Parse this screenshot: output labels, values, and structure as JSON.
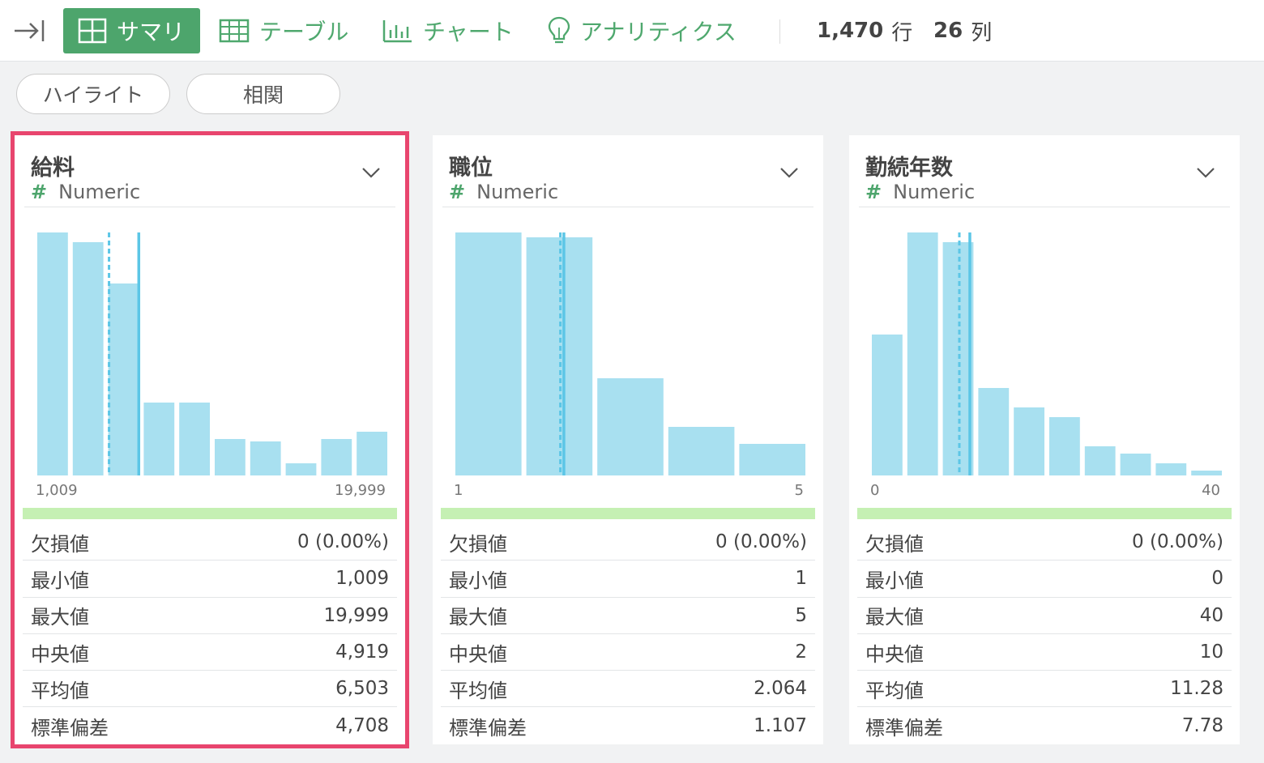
{
  "toolbar": {
    "tabs": [
      {
        "label": "サマリ",
        "icon": "grid-icon",
        "active": true
      },
      {
        "label": "テーブル",
        "icon": "table-icon",
        "active": false
      },
      {
        "label": "チャート",
        "icon": "bar-chart-icon",
        "active": false
      },
      {
        "label": "アナリティクス",
        "icon": "lightbulb-icon",
        "active": false
      }
    ],
    "rows_value": "1,470",
    "rows_unit": "行",
    "cols_value": "26",
    "cols_unit": "列"
  },
  "subtabs": [
    "ハイライト",
    "相関"
  ],
  "colors": {
    "accent_green": "#4da56c",
    "bar": "#a8e0f0",
    "median_line": "#5cc6e6",
    "quality_bar": "#c5f0b3",
    "selection": "#e8456e"
  },
  "cards": [
    {
      "title": "給料",
      "type_symbol": "#",
      "type": "Numeric",
      "selected": true,
      "axis_min": "1,009",
      "axis_max": "19,999",
      "chart_data": {
        "type": "bar",
        "bins_relative": [
          1.0,
          0.96,
          0.79,
          0.3,
          0.3,
          0.15,
          0.14,
          0.05,
          0.15,
          0.18
        ],
        "median_fraction": 0.205,
        "mean_fraction": 0.29
      },
      "stats": [
        {
          "label": "欠損値",
          "value": "0 (0.00%)"
        },
        {
          "label": "最小値",
          "value": "1,009"
        },
        {
          "label": "最大値",
          "value": "19,999"
        },
        {
          "label": "中央値",
          "value": "4,919"
        },
        {
          "label": "平均値",
          "value": "6,503"
        },
        {
          "label": "標準偏差",
          "value": "4,708"
        }
      ]
    },
    {
      "title": "職位",
      "type_symbol": "#",
      "type": "Numeric",
      "selected": false,
      "axis_min": "1",
      "axis_max": "5",
      "chart_data": {
        "type": "bar",
        "bins_relative": [
          1.0,
          0.98,
          0.4,
          0.2,
          0.13
        ],
        "median_fraction": 0.3,
        "mean_fraction": 0.31
      },
      "stats": [
        {
          "label": "欠損値",
          "value": "0 (0.00%)"
        },
        {
          "label": "最小値",
          "value": "1"
        },
        {
          "label": "最大値",
          "value": "5"
        },
        {
          "label": "中央値",
          "value": "2"
        },
        {
          "label": "平均値",
          "value": "2.064"
        },
        {
          "label": "標準偏差",
          "value": "1.107"
        }
      ]
    },
    {
      "title": "勤続年数",
      "type_symbol": "#",
      "type": "Numeric",
      "selected": false,
      "axis_min": "0",
      "axis_max": "40",
      "chart_data": {
        "type": "bar",
        "bins_relative": [
          0.58,
          1.0,
          0.96,
          0.36,
          0.28,
          0.24,
          0.12,
          0.09,
          0.05,
          0.02
        ],
        "median_fraction": 0.25,
        "mean_fraction": 0.28
      },
      "stats": [
        {
          "label": "欠損値",
          "value": "0 (0.00%)"
        },
        {
          "label": "最小値",
          "value": "0"
        },
        {
          "label": "最大値",
          "value": "40"
        },
        {
          "label": "中央値",
          "value": "10"
        },
        {
          "label": "平均値",
          "value": "11.28"
        },
        {
          "label": "標準偏差",
          "value": "7.78"
        }
      ]
    }
  ]
}
